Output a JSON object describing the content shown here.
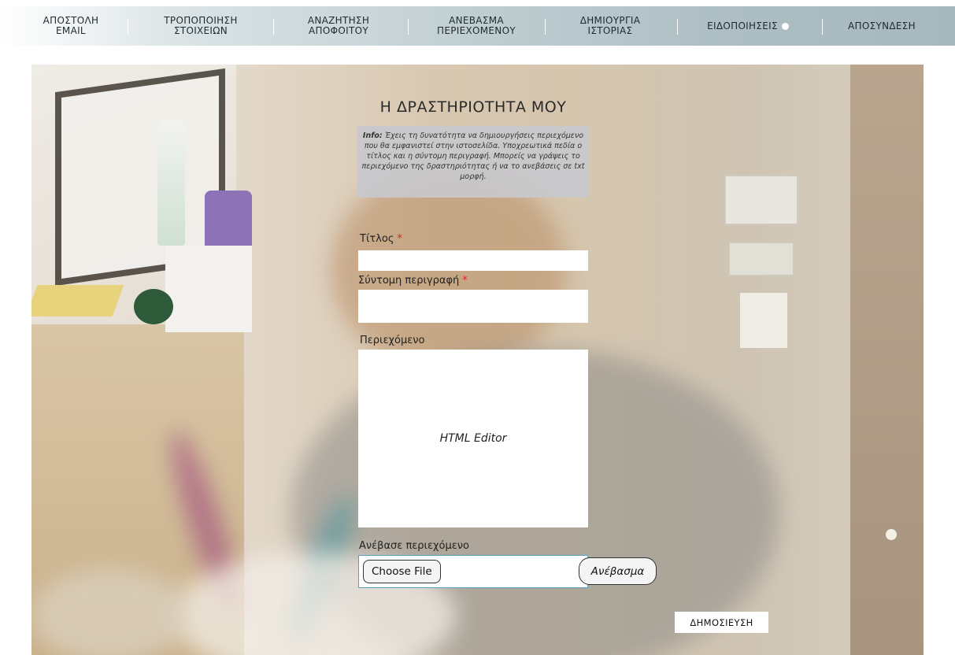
{
  "nav": {
    "items": [
      {
        "label": "ΑΠΟΣΤΟΛΗ\nEMAIL"
      },
      {
        "label": "ΤΡΟΠΟΠΟΙΗΣΗ\nΣΤΟΙΧΕΙΩΝ"
      },
      {
        "label": "ΑΝΑΖΗΤΗΣΗ\nΑΠΟΦΟΙΤΟΥ"
      },
      {
        "label": "ΑΝΕΒΑΣΜΑ\nΠΕΡΙΕΧΟΜΕΝΟΥ"
      },
      {
        "label": "ΔΗΜΙΟΥΡΓΙΑ\nΙΣΤΟΡΙΑΣ"
      },
      {
        "label": "ΕΙΔΟΠΟΙΗΣΕΙΣ"
      },
      {
        "label": "ΑΠΟΣΥΝΔΕΣΗ"
      }
    ]
  },
  "page": {
    "title": "Η ΔΡΑΣΤΗΡΙΟΤΗΤΑ ΜΟΥ",
    "info_label": "Info:",
    "info_text": " Έχεις τη δυνατότητα να δημιουργήσεις περιεχόμενο που θα εμφανιστεί στην ιστοσελίδα. Υποχρεωτικά πεδία ο τίτλος και η σύντομη περιγραφή. Μπορείς να γράψεις το περιεχόμενο της δραστηριότητας ή να το ανεβάσεις σε txt μορφή."
  },
  "form": {
    "title_label": "Τίτλος",
    "summary_label": "Σύντομη περιγραφή",
    "required_mark": "*",
    "content_label": "Περιεχόμενο",
    "editor_placeholder": "HTML Editor",
    "upload_label": "Ανέβασε περιεχόμενο",
    "choose_file": "Choose File",
    "upload_button": "Ανέβασμα",
    "publish_button": "ΔΗΜΟΣΙΕΥΣΗ"
  },
  "colors": {
    "required": "#d9262b",
    "upload_border": "#5aa0c0",
    "info_bg": "#c8c8cc"
  }
}
